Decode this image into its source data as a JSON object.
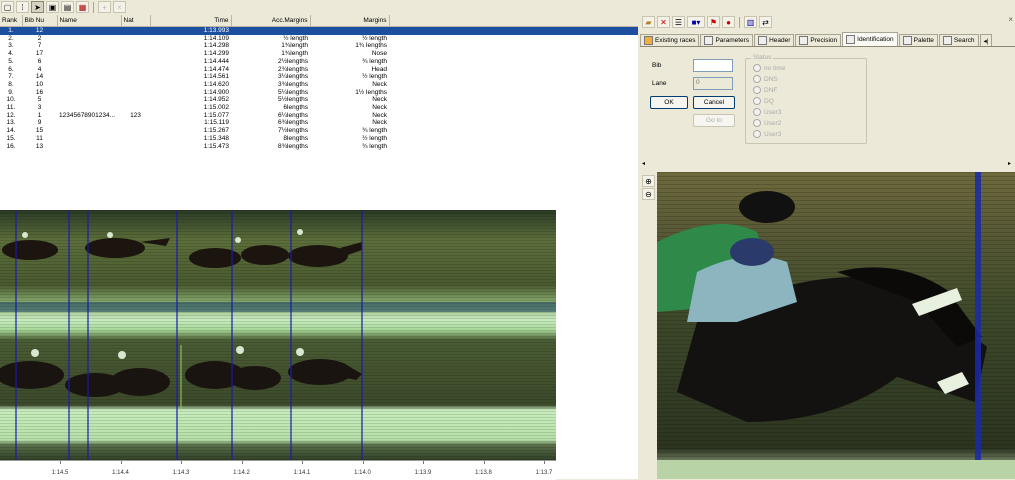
{
  "toolbar_icons": [
    "new-icon",
    "open-icon",
    "cursor-icon",
    "camera-icon",
    "table-icon",
    "film-icon",
    "plus-icon",
    "close-icon"
  ],
  "results": {
    "columns": [
      "Rank",
      "Bib Nu",
      "Name",
      "Nat",
      "Time",
      "Acc.Margins",
      "Margins"
    ],
    "rows": [
      {
        "rank": "1.",
        "bib": "12",
        "name": "",
        "nat": "",
        "time": "1:13.993",
        "acc": "",
        "margin": ""
      },
      {
        "rank": "2.",
        "bib": "2",
        "name": "",
        "nat": "",
        "time": "1:14.109",
        "acc": "½ length",
        "margin": "½ length"
      },
      {
        "rank": "3.",
        "bib": "7",
        "name": "",
        "nat": "",
        "time": "1:14.298",
        "acc": "1¾length",
        "margin": "1¾ lengths"
      },
      {
        "rank": "4.",
        "bib": "17",
        "name": "",
        "nat": "",
        "time": "1:14.299",
        "acc": "1¾length",
        "margin": "Nose"
      },
      {
        "rank": "5.",
        "bib": "6",
        "name": "",
        "nat": "",
        "time": "1:14.444",
        "acc": "2½lengths",
        "margin": "¾ length"
      },
      {
        "rank": "6.",
        "bib": "4",
        "name": "",
        "nat": "",
        "time": "1:14.474",
        "acc": "2¾lengths",
        "margin": "Head"
      },
      {
        "rank": "7.",
        "bib": "14",
        "name": "",
        "nat": "",
        "time": "1:14.561",
        "acc": "3¼lengths",
        "margin": "½ length"
      },
      {
        "rank": "8.",
        "bib": "10",
        "name": "",
        "nat": "",
        "time": "1:14.620",
        "acc": "3¾lengths",
        "margin": "Neck"
      },
      {
        "rank": "9.",
        "bib": "16",
        "name": "",
        "nat": "",
        "time": "1:14.900",
        "acc": "5¼lengths",
        "margin": "1½ lengths"
      },
      {
        "rank": "10.",
        "bib": "5",
        "name": "",
        "nat": "",
        "time": "1:14.952",
        "acc": "5½lengths",
        "margin": "Neck"
      },
      {
        "rank": "11.",
        "bib": "3",
        "name": "",
        "nat": "",
        "time": "1:15.002",
        "acc": "6lengths",
        "margin": "Neck"
      },
      {
        "rank": "12.",
        "bib": "1",
        "name": "12345678901234...",
        "nat": "123",
        "time": "1:15.077",
        "acc": "6¼lengths",
        "margin": "Neck"
      },
      {
        "rank": "13.",
        "bib": "9",
        "name": "",
        "nat": "",
        "time": "1:15.119",
        "acc": "6¾lengths",
        "margin": "Neck"
      },
      {
        "rank": "14.",
        "bib": "15",
        "name": "",
        "nat": "",
        "time": "1:15.267",
        "acc": "7½lengths",
        "margin": "¾ length"
      },
      {
        "rank": "15.",
        "bib": "11",
        "name": "",
        "nat": "",
        "time": "1:15.348",
        "acc": "8lengths",
        "margin": "½ length"
      },
      {
        "rank": "16.",
        "bib": "13",
        "name": "",
        "nat": "",
        "time": "1:15.473",
        "acc": "8¾lengths",
        "margin": "¾ length"
      }
    ]
  },
  "time_axis": [
    "1:14.5",
    "1:14.4",
    "1:14.3",
    "1:14.2",
    "1:14.1",
    "1:14.0",
    "1:13.9",
    "1:13.8",
    "1:13.7"
  ],
  "right_toolbar_icons": [
    "folder-icon",
    "delete-icon",
    "list-icon",
    "color-icon",
    "flag-icon",
    "stop-icon",
    "columns-icon",
    "export-icon"
  ],
  "tabs": [
    {
      "label": "Existing races",
      "icon": "flag-icon"
    },
    {
      "label": "Parameters",
      "icon": "wrench-icon"
    },
    {
      "label": "Header",
      "icon": "header-icon"
    },
    {
      "label": "Precision",
      "icon": "precision-icon"
    },
    {
      "label": "Identification",
      "icon": "id-icon"
    },
    {
      "label": "Palette",
      "icon": "palette-icon"
    },
    {
      "label": "Search",
      "icon": "search-icon"
    }
  ],
  "active_tab": "Identification",
  "ident": {
    "bib_label": "Bib",
    "lane_label": "Lane",
    "lane_value": "0",
    "ok": "OK",
    "cancel": "Cancel",
    "goto": "Go to",
    "status_label": "Status",
    "status_options": [
      "no time",
      "DNS",
      "DNF",
      "DQ",
      "User3",
      "User2",
      "User3"
    ]
  },
  "colors": {
    "selection": "#1c4fa0",
    "cursor_line": "#1a1ab0",
    "panel_bg": "#ece9d8"
  }
}
